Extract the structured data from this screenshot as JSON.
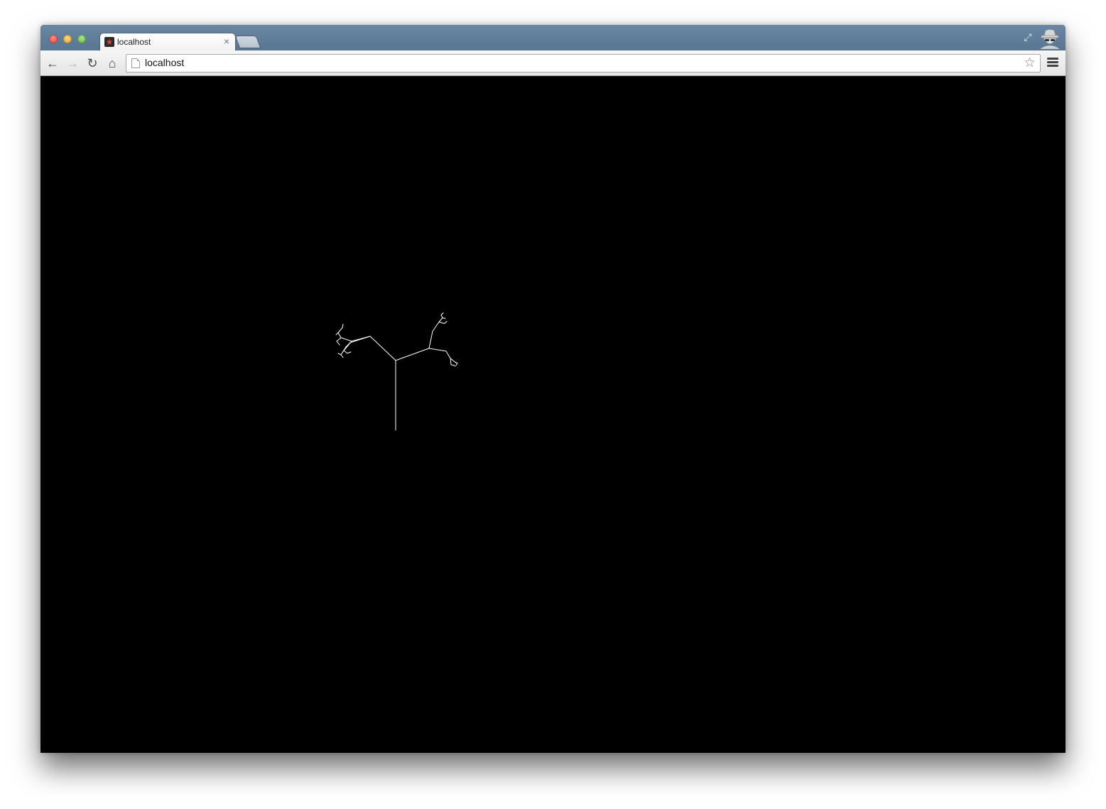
{
  "browser": {
    "tab": {
      "title": "localhost",
      "favicon_glyph": "★",
      "close_glyph": "×"
    },
    "toolbar": {
      "back_glyph": "←",
      "forward_glyph": "→",
      "reload_glyph": "↻",
      "home_glyph": "⌂",
      "url": "localhost",
      "star_glyph": "☆"
    },
    "icons": {
      "fullscreen": "fullscreen-icon",
      "incognito": "incognito-icon",
      "menu": "menu-icon"
    }
  },
  "page": {
    "background_color": "#000000",
    "stroke_color": "#ffffff",
    "content": "fractal-tree-drawing"
  }
}
